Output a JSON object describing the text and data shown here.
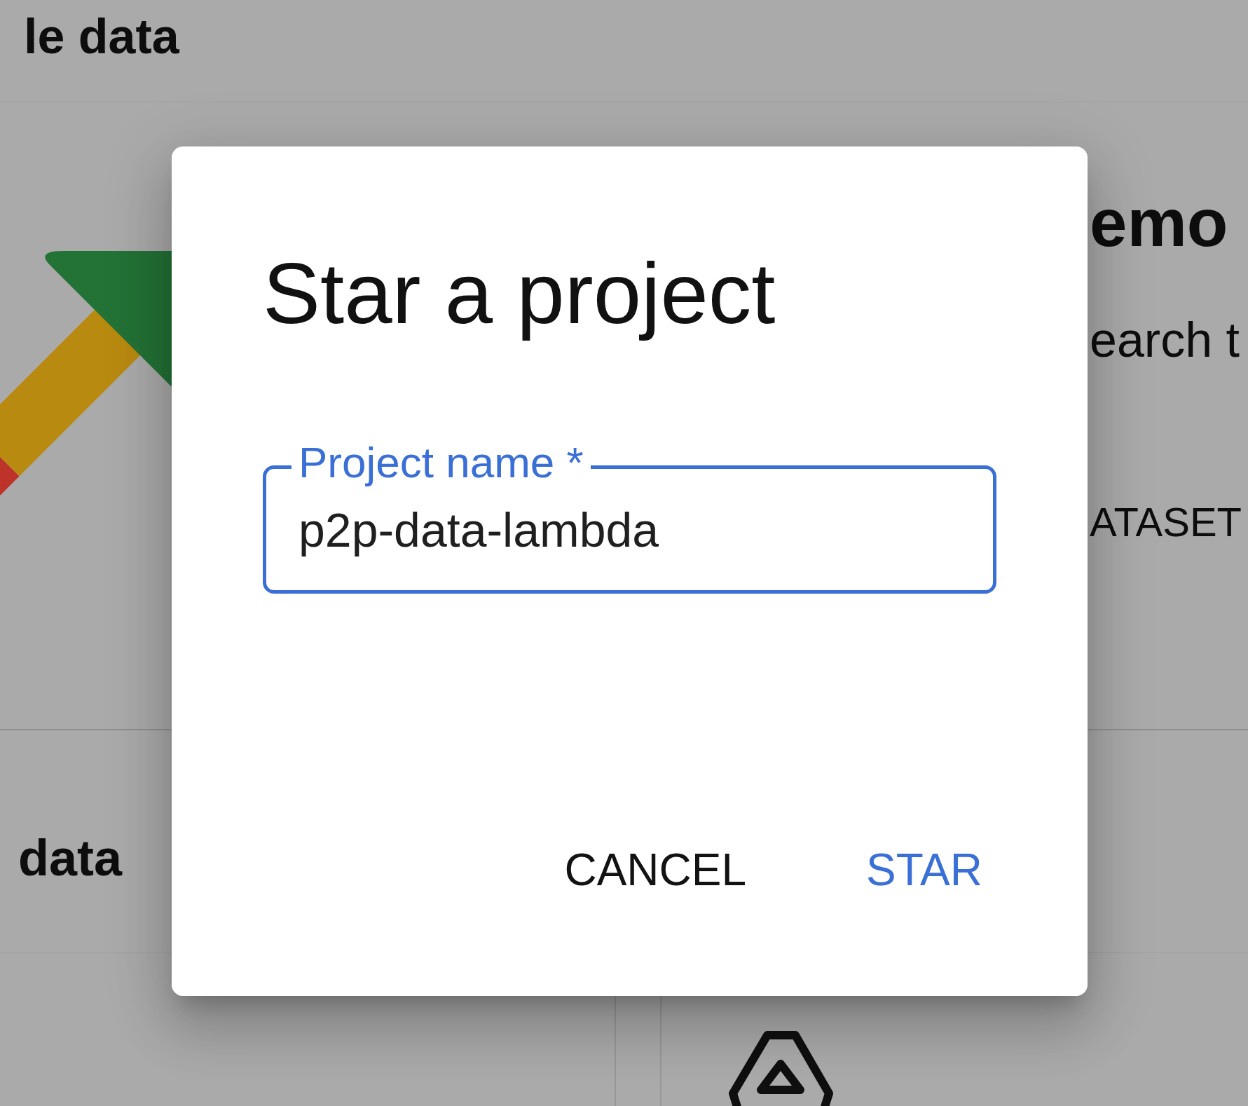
{
  "background": {
    "page_heading": "le data",
    "upper_card": {
      "title": "emo",
      "description": "earch t",
      "action": "ATASET"
    },
    "lower_card": {
      "title": "data"
    }
  },
  "dialog": {
    "title": "Star a project",
    "field": {
      "label": "Project name *",
      "value": "p2p-data-lambda",
      "focused": true
    },
    "buttons": [
      {
        "label": "CANCEL",
        "kind": "cancel"
      },
      {
        "label": "STAR",
        "kind": "confirm"
      }
    ]
  }
}
